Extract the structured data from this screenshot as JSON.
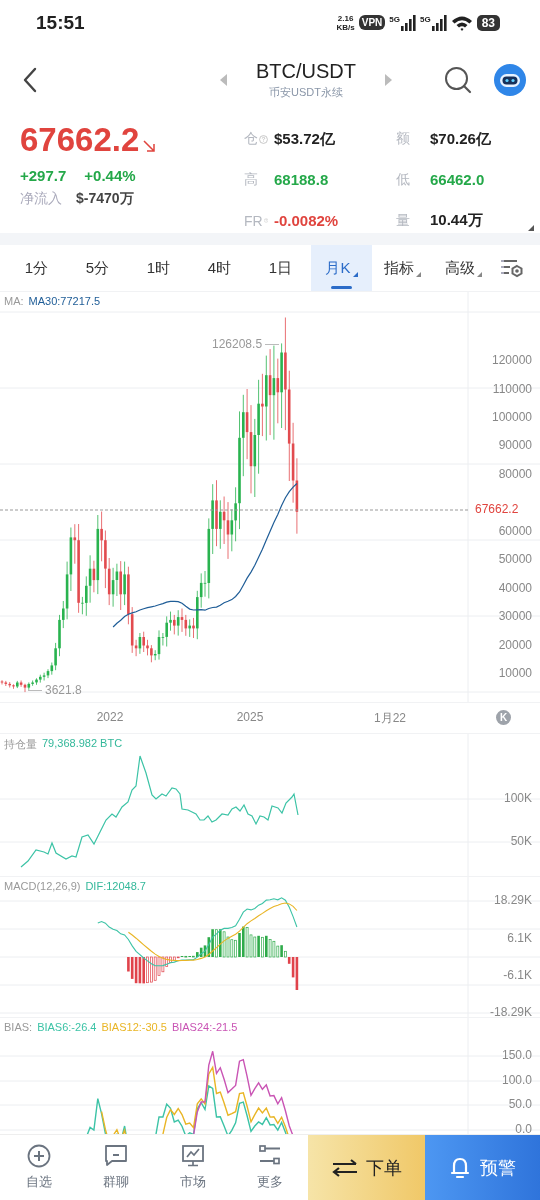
{
  "status_bar": {
    "time": "15:51",
    "net_speed": "2.16",
    "net_unit": "KB/s",
    "vpn": "VPN",
    "networks": [
      "5G",
      "5G"
    ],
    "battery": "83"
  },
  "header": {
    "title": "BTC/USDT",
    "subtitle": "币安USDT永续"
  },
  "quote": {
    "price": "67662.2",
    "change": "+297.7",
    "change_pct": "+0.44%",
    "net_inflow_label": "净流入",
    "net_inflow_value": "$-7470万",
    "stats": [
      {
        "label": "仓",
        "help": true,
        "value": "$53.72亿",
        "color": "#222222"
      },
      {
        "label": "额",
        "help": false,
        "value": "$70.26亿",
        "color": "#222222"
      },
      {
        "label": "高",
        "help": false,
        "value": "68188.8",
        "color": "#24a849"
      },
      {
        "label": "低",
        "help": false,
        "value": "66462.0",
        "color": "#24a849"
      },
      {
        "label": "FR",
        "help": true,
        "value": "-0.0082%",
        "color": "#e0443e"
      },
      {
        "label": "量",
        "help": false,
        "value": "10.44万",
        "color": "#222222"
      }
    ]
  },
  "tabs": [
    {
      "label": "1分",
      "selected": false,
      "caret": false
    },
    {
      "label": "5分",
      "selected": false,
      "caret": false
    },
    {
      "label": "1时",
      "selected": false,
      "caret": false
    },
    {
      "label": "4时",
      "selected": false,
      "caret": false
    },
    {
      "label": "1日",
      "selected": false,
      "caret": false
    },
    {
      "label": "月K",
      "selected": true,
      "caret": true
    },
    {
      "label": "指标",
      "selected": false,
      "caret": true
    },
    {
      "label": "高级",
      "selected": false,
      "caret": true
    }
  ],
  "main_chart": {
    "ma_label": "MA:",
    "ma_value": "MA30:77217.5",
    "high_label": "126208.5",
    "low_label": "3621.8",
    "current_price": "67662.2",
    "y_ticks": [
      "120000",
      "110000",
      "100000",
      "90000",
      "80000",
      "60000",
      "50000",
      "40000",
      "30000",
      "20000",
      "10000"
    ],
    "x_labels": [
      "2022",
      "2025",
      "1月22"
    ],
    "candle_toggle": "K"
  },
  "open_interest": {
    "label": "持仓量",
    "value": "79,368.982 BTC",
    "y_ticks": [
      "100K",
      "50K"
    ]
  },
  "macd": {
    "label": "MACD(12,26,9)",
    "dif": "DIF:12048.7",
    "y_ticks": [
      "18.29K",
      "6.1K",
      "-6.1K",
      "-18.29K"
    ]
  },
  "bias": {
    "label": "BIAS:",
    "series": [
      {
        "label": "BIAS6:-26.4",
        "color": "#3cc3a6"
      },
      {
        "label": "BIAS12:-30.5",
        "color": "#e9b525"
      },
      {
        "label": "BIAS24:-21.5",
        "color": "#c954b4"
      }
    ],
    "y_ticks": [
      "150.0",
      "100.0",
      "50.0",
      "0.0"
    ]
  },
  "bottom_nav": {
    "items": [
      "自选",
      "群聊",
      "市场",
      "更多"
    ],
    "order_button": "下单",
    "alert_button": "预警"
  }
}
